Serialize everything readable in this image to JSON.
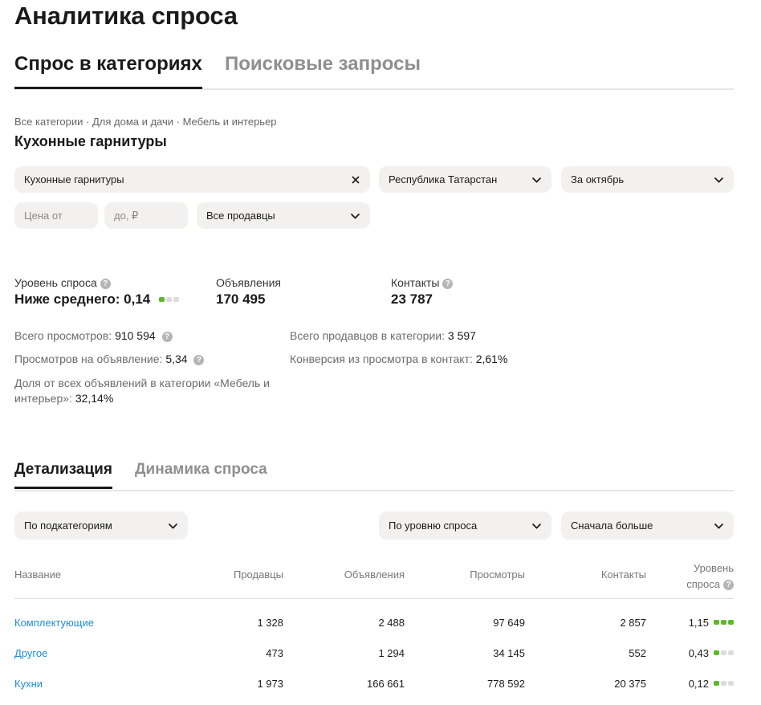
{
  "page": {
    "title": "Аналитика спроса"
  },
  "main_tabs": [
    {
      "label": "Спрос в категориях",
      "active": true
    },
    {
      "label": "Поисковые запросы",
      "active": false
    }
  ],
  "breadcrumb": "Все категории · Для дома и дачи · Мебель и интерьер",
  "category_title": "Кухонные гарнитуры",
  "filters": {
    "category": {
      "value": "Кухонные гарнитуры"
    },
    "region": {
      "value": "Республика Татарстан"
    },
    "period": {
      "value": "За октябрь"
    },
    "price_from": {
      "placeholder": "Цена от"
    },
    "price_to": {
      "placeholder": "до, ₽"
    },
    "sellers": {
      "value": "Все продавцы"
    }
  },
  "stats": {
    "demand": {
      "label": "Уровень спроса",
      "value": "Ниже среднего: 0,14",
      "level": 1,
      "max": 3
    },
    "listings": {
      "label": "Объявления",
      "value": "170 495"
    },
    "contacts": {
      "label": "Контакты",
      "value": "23 787"
    }
  },
  "metrics": {
    "total_views": {
      "label": "Всего просмотров:",
      "value": "910 594"
    },
    "views_per_listing": {
      "label": "Просмотров на объявление:",
      "value": "5,34"
    },
    "share_line1": "Доля от всех объявлений в категории «Мебель и",
    "share_line2": "интерьер»:",
    "share_value": "32,14%",
    "total_sellers": {
      "label": "Всего продавцов в категории:",
      "value": "3 597"
    },
    "conversion": {
      "label": "Конверсия из просмотра в контакт:",
      "value": "2,61%"
    }
  },
  "sub_tabs": [
    {
      "label": "Детализация",
      "active": true
    },
    {
      "label": "Динамика спроса",
      "active": false
    }
  ],
  "table_controls": {
    "grouping": "По подкатегориям",
    "sort_by": "По уровню спроса",
    "order": "Сначала больше"
  },
  "table": {
    "headers": {
      "name": "Название",
      "sellers": "Продавцы",
      "listings": "Объявления",
      "views": "Просмотры",
      "contacts": "Контакты",
      "demand_line1": "Уровень",
      "demand_line2": "спроса"
    },
    "rows": [
      {
        "name": "Комплектующие",
        "sellers": "1 328",
        "listings": "2 488",
        "views": "97 649",
        "contacts": "2 857",
        "demand": "1,15",
        "level": 3
      },
      {
        "name": "Другое",
        "sellers": "473",
        "listings": "1 294",
        "views": "34 145",
        "contacts": "552",
        "demand": "0,43",
        "level": 1
      },
      {
        "name": "Кухни",
        "sellers": "1 973",
        "listings": "166 661",
        "views": "778 592",
        "contacts": "20 375",
        "demand": "0,12",
        "level": 1
      }
    ]
  },
  "colors": {
    "accent_green": "#5cb82a",
    "link_blue": "#1e8dd6",
    "field_bg": "#f2f1f0"
  },
  "icons": [
    "close-icon",
    "chevron-down-icon",
    "question-icon"
  ]
}
